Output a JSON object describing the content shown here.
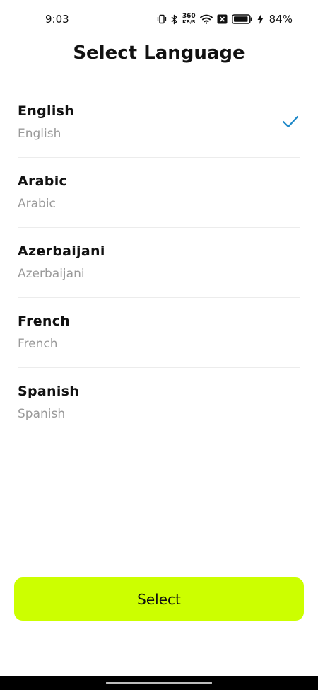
{
  "status_bar": {
    "time": "9:03",
    "net_speed_value": "360",
    "net_speed_unit": "KB/S",
    "battery_percent": "84%",
    "icons": [
      "vibrate-icon",
      "bluetooth-icon",
      "wifi-icon",
      "sim-x-icon",
      "battery-icon",
      "charging-bolt-icon"
    ]
  },
  "header": {
    "title": "Select Language"
  },
  "languages": [
    {
      "name": "English",
      "native": "English",
      "selected": true
    },
    {
      "name": "Arabic",
      "native": "Arabic",
      "selected": false
    },
    {
      "name": "Azerbaijani",
      "native": "Azerbaijani",
      "selected": false
    },
    {
      "name": "French",
      "native": "French",
      "selected": false
    },
    {
      "name": "Spanish",
      "native": "Spanish",
      "selected": false
    }
  ],
  "actions": {
    "select_label": "Select"
  },
  "colors": {
    "accent": "#ccff00",
    "check": "#1e88c8",
    "secondary_text": "#9a9a9a"
  }
}
